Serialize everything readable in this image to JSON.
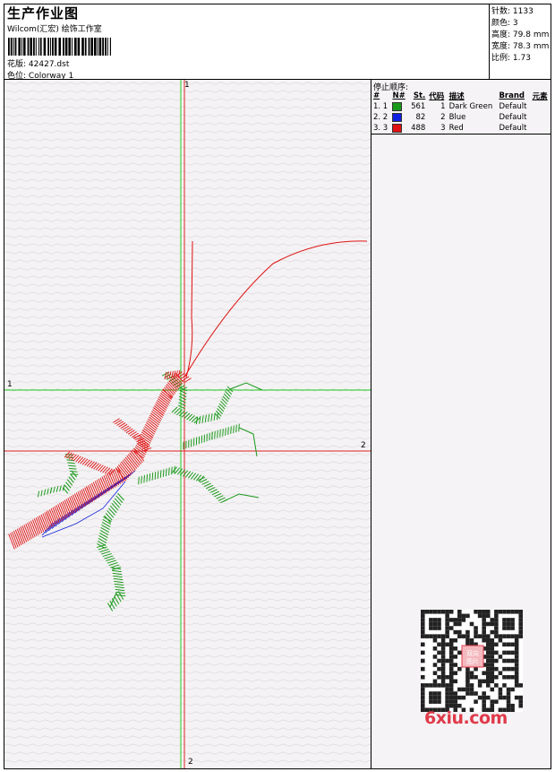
{
  "header": {
    "title": "生产作业图",
    "company": "Wilcom(汇宏) 绘饰工作室",
    "design_label": "花版:",
    "design_value": "42427.dst",
    "colorway_label": "色位:",
    "colorway_value": "Colorway 1"
  },
  "stats": [
    {
      "label": "针数:",
      "value": "1133"
    },
    {
      "label": "颜色:",
      "value": "3"
    },
    {
      "label": "高度:",
      "value": "79.8 mm"
    },
    {
      "label": "宽度:",
      "value": "78.3 mm"
    },
    {
      "label": "比例:",
      "value": "1.73"
    }
  ],
  "stop_sequence": {
    "title": "停止顺序:",
    "columns": [
      "#",
      "N#",
      "St.",
      "代码",
      "描述",
      "Brand",
      "元素"
    ],
    "rows": [
      {
        "index": "1.",
        "n": "1",
        "color": "#1a9a1a",
        "stitches": "561",
        "code": "1",
        "description": "Dark Green",
        "brand": "Default"
      },
      {
        "index": "2.",
        "n": "2",
        "color": "#1020e0",
        "stitches": "82",
        "code": "2",
        "description": "Blue",
        "brand": "Default"
      },
      {
        "index": "3.",
        "n": "3",
        "color": "#e01010",
        "stitches": "488",
        "code": "3",
        "description": "Red",
        "brand": "Default"
      }
    ]
  },
  "axes": {
    "vertical_top": "1",
    "vertical_bottom": "2",
    "horizontal_green": "1",
    "horizontal_red": "2"
  },
  "watermark": {
    "qr_text": "双向图片",
    "site": "6xiu.com"
  },
  "colors": {
    "green_axis": "#22cc22",
    "red_axis": "#dd2222",
    "thread_green": "#1a9a1a",
    "thread_blue": "#1020e0",
    "thread_red": "#e01010"
  }
}
